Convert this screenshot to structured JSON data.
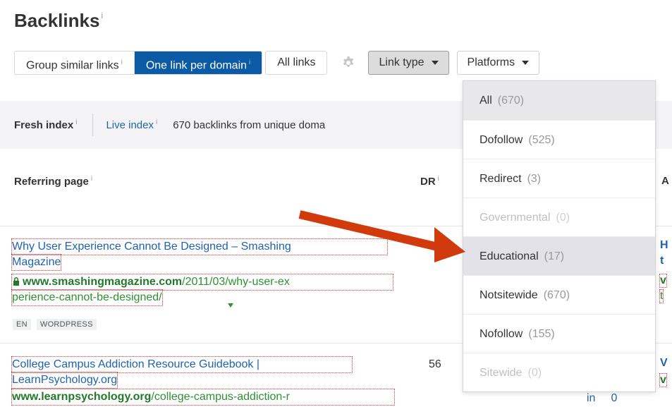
{
  "header": {
    "title": "Backlinks",
    "info": "i"
  },
  "toolbar": {
    "group_similar": "Group similar links",
    "one_per_domain": "One link per domain",
    "all_links": "All links",
    "settings_icon": "gear-icon",
    "link_type": "Link type",
    "platforms": "Platforms",
    "info": "i"
  },
  "index_bar": {
    "fresh": "Fresh index",
    "live": "Live index",
    "summary": "670 backlinks from unique doma",
    "info": "i"
  },
  "table": {
    "headers": {
      "referring_page": "Referring page",
      "dr": "DR",
      "next": "A",
      "info": "i"
    },
    "rows": [
      {
        "title_line1": "Why User Experience Cannot Be Designed – Smashing",
        "title_line2": "Magazine",
        "secure": true,
        "domain": "www.smashingmagazine.com",
        "path_line1": "/2011/03/why-user-ex",
        "path_line2": "perience-cannot-be-designed/",
        "tags": [
          "EN",
          "WORDPRESS"
        ],
        "dr": "",
        "right_clip": [
          "H",
          "t",
          "v",
          "t"
        ]
      },
      {
        "title_line1": "College Campus Addiction Resource Guidebook |",
        "title_line2": "LearnPsychology.org",
        "secure": false,
        "domain": "www.learnpsychology.org",
        "path_line1": "/college-campus-addiction-r",
        "dr": "56",
        "right_clip": [
          "V",
          "v"
        ]
      }
    ],
    "partial_cells": {
      "in": "in",
      "zero": "0"
    }
  },
  "link_type_menu": {
    "items": [
      {
        "label": "All",
        "count": "(670)",
        "state": "selected"
      },
      {
        "label": "Dofollow",
        "count": "(525)",
        "state": "normal"
      },
      {
        "label": "Redirect",
        "count": "(3)",
        "state": "normal"
      },
      {
        "label": "Governmental",
        "count": "(0)",
        "state": "disabled"
      },
      {
        "label": "Educational",
        "count": "(17)",
        "state": "highlighted"
      },
      {
        "label": "Notsitewide",
        "count": "(670)",
        "state": "normal"
      },
      {
        "label": "Nofollow",
        "count": "(155)",
        "state": "normal"
      },
      {
        "label": "Sitewide",
        "count": "(0)",
        "state": "disabled"
      }
    ]
  },
  "annotation": {
    "arrow_color": "#d13a0c",
    "points_to": "Educational"
  },
  "colors": {
    "accent": "#0a5aa5",
    "link": "#1f62b0",
    "url_green": "#2f8f33"
  }
}
